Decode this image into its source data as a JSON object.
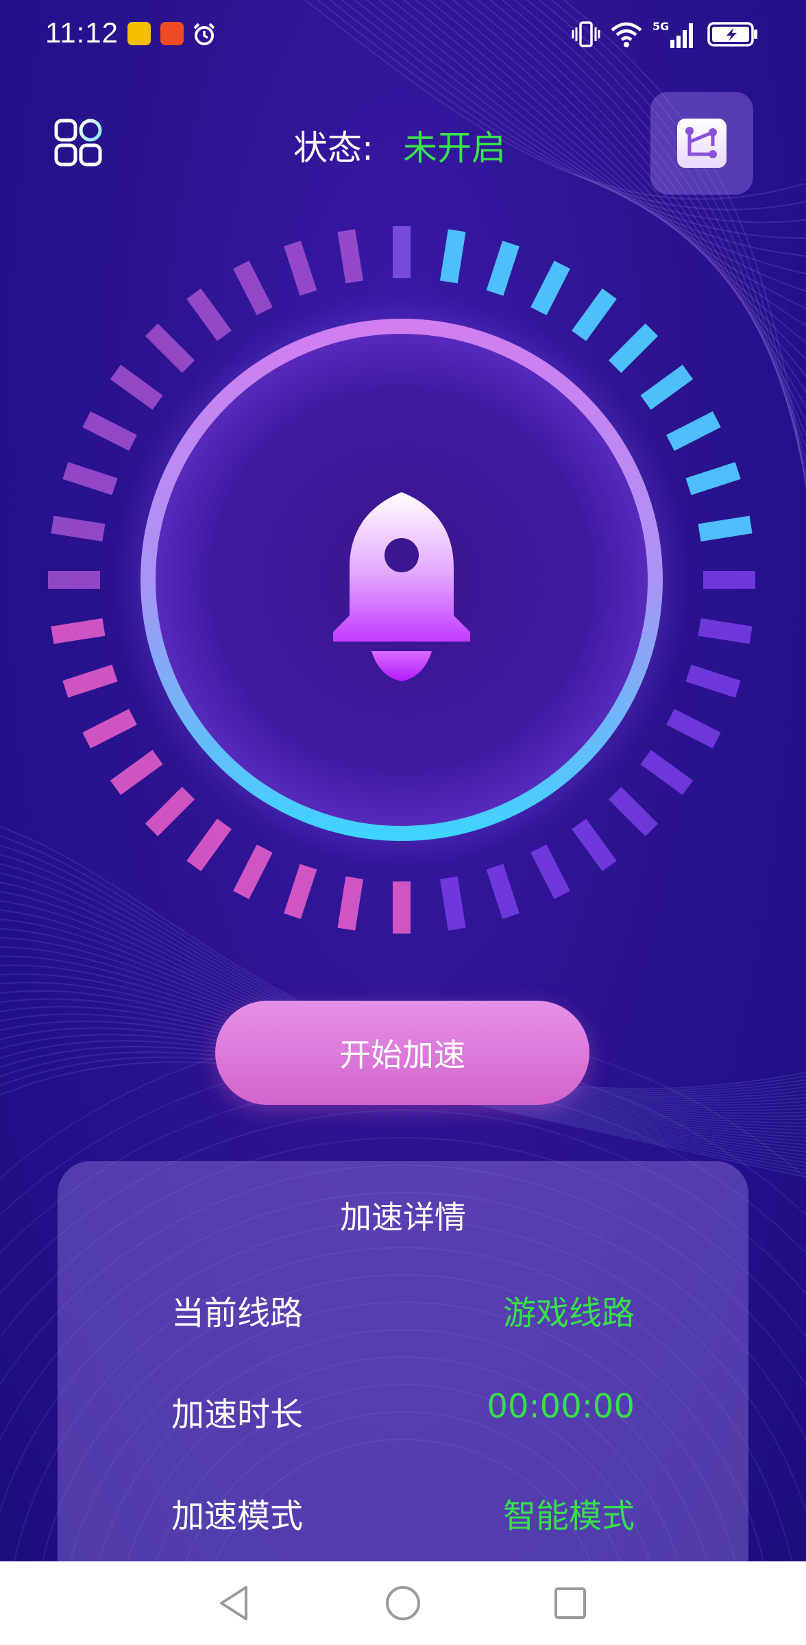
{
  "status_bar": {
    "time": "11:12",
    "network_label": "5G"
  },
  "header": {
    "status_label": "状态:",
    "status_value": "未开启"
  },
  "actions": {
    "start_label": "开始加速"
  },
  "details": {
    "title": "加速详情",
    "rows": [
      {
        "label": "当前线路",
        "value": "游戏线路"
      },
      {
        "label": "加速时长",
        "value": "00:00:00"
      },
      {
        "label": "加速模式",
        "value": "智能模式"
      }
    ]
  },
  "colors": {
    "accent_green": "#39e34a",
    "button_pink": "#d264cc",
    "background": "#2c138f"
  },
  "icons": [
    "grid-icon",
    "route-icon",
    "rocket-icon",
    "back-icon",
    "home-icon",
    "recents-icon"
  ]
}
